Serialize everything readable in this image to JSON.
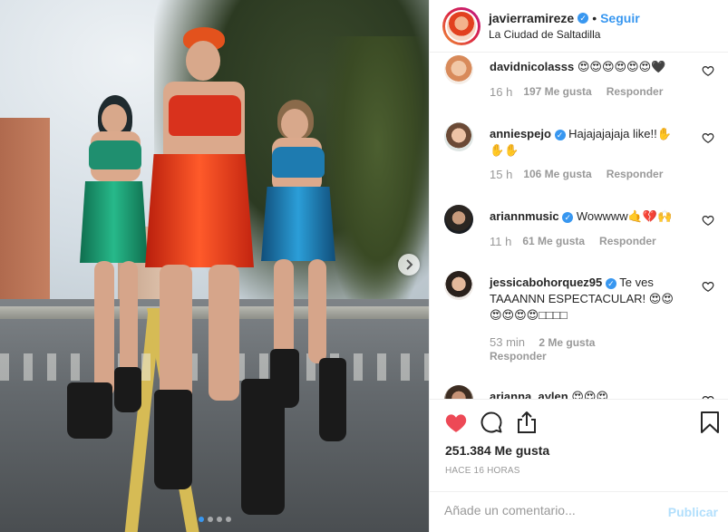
{
  "post": {
    "username": "javierramireze",
    "verified": true,
    "follow_label": "Seguir",
    "separator": "•",
    "location": "La Ciudad de Saltadilla",
    "likes_text": "251.384 Me gusta",
    "time_ago": "HACE 16 HORAS",
    "carousel_index": 1,
    "carousel_count": 4
  },
  "comments": [
    {
      "user": "davidnicolasss",
      "text": "😍😍😍😍😍😍🖤",
      "time": "16 h",
      "likes": "197 Me gusta",
      "reply": "Responder"
    },
    {
      "user": "anniespejo",
      "text": "Hajajajajaja like!!✋✋✋",
      "time": "15 h",
      "likes": "106 Me gusta",
      "reply": "Responder"
    },
    {
      "user": "ariannmusic",
      "text": "Wowwww🤙💔🙌",
      "time": "11 h",
      "likes": "61 Me gusta",
      "reply": "Responder"
    },
    {
      "user": "jessicabohorquez95",
      "text": "Te ves TAAANNN ESPECTACULAR! 😍😍😍😍😍😍□□□□",
      "time": "53 min",
      "likes": "2 Me gusta",
      "reply": "Responder"
    },
    {
      "user": "arianna_aylen",
      "text": "😍😍😍",
      "time": "",
      "likes": "",
      "reply": ""
    }
  ],
  "add_comment": {
    "placeholder": "Añade un comentario...",
    "publish_label": "Publicar"
  },
  "colors": {
    "link": "#3897f0",
    "like": "#ed4956",
    "muted": "#999999"
  },
  "icons": [
    "heart-icon",
    "comment-icon",
    "share-icon",
    "bookmark-icon",
    "chevron-right-icon",
    "verified-icon"
  ]
}
